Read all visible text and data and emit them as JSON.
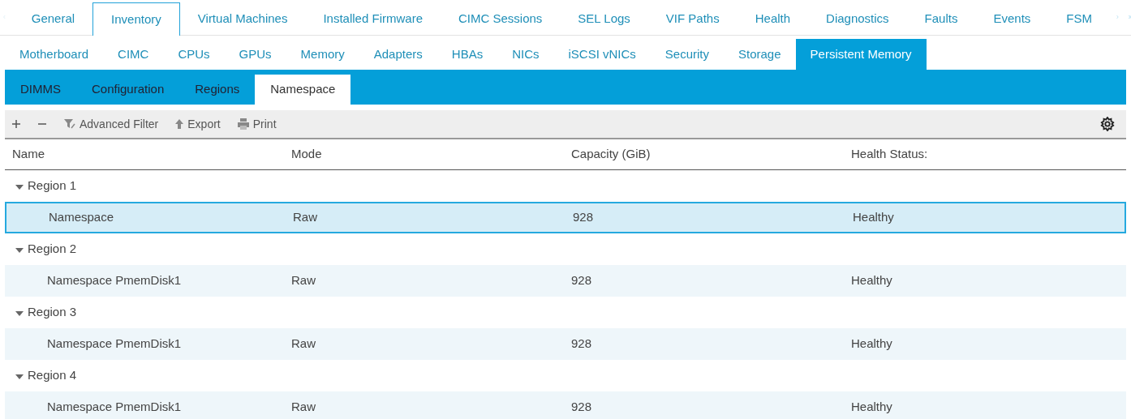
{
  "main_tabs": [
    {
      "label": "General",
      "selected": false
    },
    {
      "label": "Inventory",
      "selected": true
    },
    {
      "label": "Virtual Machines",
      "selected": false
    },
    {
      "label": "Installed Firmware",
      "selected": false
    },
    {
      "label": "CIMC Sessions",
      "selected": false
    },
    {
      "label": "SEL Logs",
      "selected": false
    },
    {
      "label": "VIF Paths",
      "selected": false
    },
    {
      "label": "Health",
      "selected": false
    },
    {
      "label": "Diagnostics",
      "selected": false
    },
    {
      "label": "Faults",
      "selected": false
    },
    {
      "label": "Events",
      "selected": false
    },
    {
      "label": "FSM",
      "selected": false
    }
  ],
  "inventory_tabs": [
    {
      "label": "Motherboard",
      "selected": false
    },
    {
      "label": "CIMC",
      "selected": false
    },
    {
      "label": "CPUs",
      "selected": false
    },
    {
      "label": "GPUs",
      "selected": false
    },
    {
      "label": "Memory",
      "selected": false
    },
    {
      "label": "Adapters",
      "selected": false
    },
    {
      "label": "HBAs",
      "selected": false
    },
    {
      "label": "NICs",
      "selected": false
    },
    {
      "label": "iSCSI vNICs",
      "selected": false
    },
    {
      "label": "Security",
      "selected": false
    },
    {
      "label": "Storage",
      "selected": false
    },
    {
      "label": "Persistent Memory",
      "selected": true
    }
  ],
  "pmem_tabs": [
    {
      "label": "DIMMS",
      "selected": false
    },
    {
      "label": "Configuration",
      "selected": false
    },
    {
      "label": "Regions",
      "selected": false
    },
    {
      "label": "Namespace",
      "selected": true
    }
  ],
  "toolbar": {
    "items": [
      {
        "kind": "add"
      },
      {
        "kind": "remove"
      },
      {
        "kind": "filter",
        "label": "Advanced Filter"
      },
      {
        "kind": "export",
        "label": "Export"
      },
      {
        "kind": "print",
        "label": "Print"
      }
    ]
  },
  "table": {
    "columns": [
      "Name",
      "Mode",
      "Capacity (GiB)",
      "Health Status:"
    ],
    "groups": [
      {
        "name": "Region 1",
        "expanded": true,
        "children": [
          {
            "cells": [
              "Namespace",
              "Raw",
              "928",
              "Healthy"
            ],
            "selected": true
          }
        ]
      },
      {
        "name": "Region 2",
        "expanded": true,
        "children": [
          {
            "cells": [
              "Namespace PmemDisk1",
              "Raw",
              "928",
              "Healthy"
            ],
            "selected": false
          }
        ]
      },
      {
        "name": "Region 3",
        "expanded": true,
        "children": [
          {
            "cells": [
              "Namespace PmemDisk1",
              "Raw",
              "928",
              "Healthy"
            ],
            "selected": false
          }
        ]
      },
      {
        "name": "Region 4",
        "expanded": true,
        "children": [
          {
            "cells": [
              "Namespace PmemDisk1",
              "Raw",
              "928",
              "Healthy"
            ],
            "selected": false
          }
        ]
      }
    ]
  }
}
